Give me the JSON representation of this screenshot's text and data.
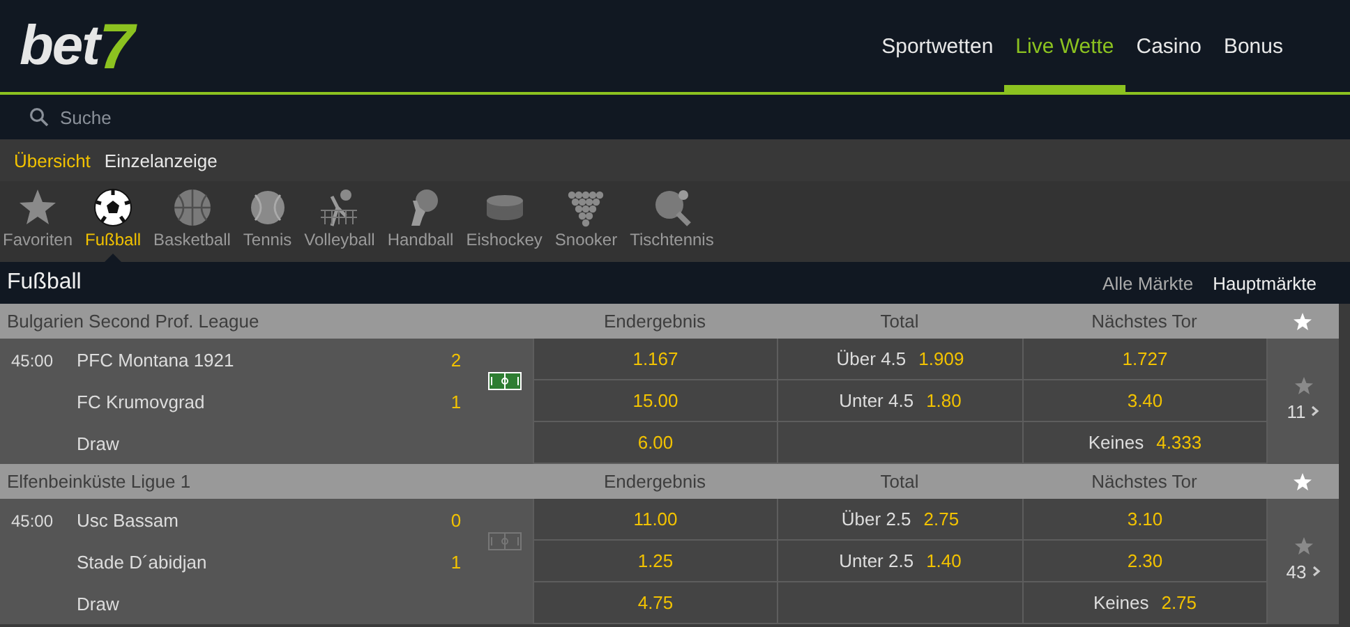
{
  "logo": {
    "word": "bet",
    "mark": "7"
  },
  "nav": [
    {
      "label": "Sportwetten",
      "selected": false
    },
    {
      "label": "Live Wette",
      "selected": true
    },
    {
      "label": "Casino",
      "selected": false
    },
    {
      "label": "Bonus",
      "selected": false
    }
  ],
  "search": {
    "placeholder": "Suche"
  },
  "view_tabs": [
    {
      "label": "Übersicht",
      "selected": true
    },
    {
      "label": "Einzelanzeige",
      "selected": false
    }
  ],
  "sports": [
    {
      "label": "Favoriten",
      "selected": false
    },
    {
      "label": "Fußball",
      "selected": true
    },
    {
      "label": "Basketball",
      "selected": false
    },
    {
      "label": "Tennis",
      "selected": false
    },
    {
      "label": "Volleyball",
      "selected": false
    },
    {
      "label": "Handball",
      "selected": false
    },
    {
      "label": "Eishockey",
      "selected": false
    },
    {
      "label": "Snooker",
      "selected": false
    },
    {
      "label": "Tischtennis",
      "selected": false
    }
  ],
  "section": {
    "title": "Fußball",
    "markets": [
      {
        "label": "Alle Märkte",
        "selected": false
      },
      {
        "label": "Hauptmärkte",
        "selected": true
      }
    ]
  },
  "leagues": [
    {
      "name": "Bulgarien Second Prof. League",
      "columns": [
        "Endergebnis",
        "Total",
        "Nächstes Tor"
      ],
      "match": {
        "time": "45:00",
        "field_active": true,
        "more": "11",
        "rows": [
          {
            "team": "PFC Montana 1921",
            "score": "2",
            "result": "1.167",
            "total": {
              "label": "Über 4.5",
              "odd": "1.909"
            },
            "next": {
              "odd": "1.727"
            }
          },
          {
            "team": "FC Krumovgrad",
            "score": "1",
            "result": "15.00",
            "total": {
              "label": "Unter 4.5",
              "odd": "1.80"
            },
            "next": {
              "odd": "3.40"
            }
          },
          {
            "team": "Draw",
            "result": "6.00",
            "next": {
              "label": "Keines",
              "odd": "4.333"
            }
          }
        ]
      }
    },
    {
      "name": "Elfenbeinküste Ligue 1",
      "columns": [
        "Endergebnis",
        "Total",
        "Nächstes Tor"
      ],
      "match": {
        "time": "45:00",
        "field_active": false,
        "more": "43",
        "rows": [
          {
            "team": "Usc Bassam",
            "score": "0",
            "result": "11.00",
            "total": {
              "label": "Über 2.5",
              "odd": "2.75"
            },
            "next": {
              "odd": "3.10"
            }
          },
          {
            "team": "Stade D´abidjan",
            "score": "1",
            "result": "1.25",
            "total": {
              "label": "Unter 2.5",
              "odd": "1.40"
            },
            "next": {
              "odd": "2.30"
            }
          },
          {
            "team": "Draw",
            "result": "4.75",
            "next": {
              "label": "Keines",
              "odd": "2.75"
            }
          }
        ]
      }
    }
  ]
}
